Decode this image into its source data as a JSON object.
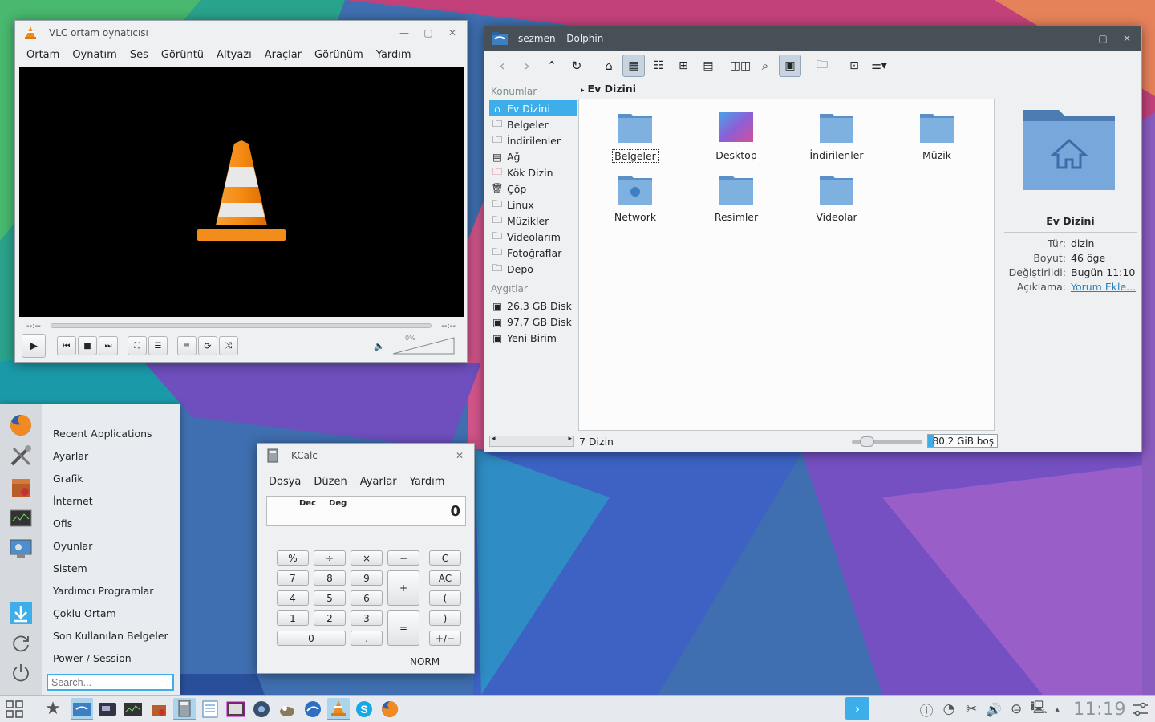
{
  "vlc": {
    "title": "VLC ortam oynatıcısı",
    "menu": [
      "Ortam",
      "Oynatım",
      "Ses",
      "Görüntü",
      "Altyazı",
      "Araçlar",
      "Görünüm",
      "Yardım"
    ],
    "elapsed": "--:--",
    "remaining": "--:--",
    "volume": "0%"
  },
  "dolphin": {
    "title": "sezmen – Dolphin",
    "places_header": "Konumlar",
    "places": [
      "Ev Dizini",
      "Belgeler",
      "İndirilenler",
      "Ağ",
      "Kök Dizin",
      "Çöp",
      "Linux",
      "Müzikler",
      "Videolarım",
      "Fotoğraflar",
      "Depo"
    ],
    "devices_header": "Aygıtlar",
    "devices": [
      "26,3 GB Disk",
      "97,7 GB Disk",
      "Yeni Birim"
    ],
    "breadcrumb": "Ev Dizini",
    "files": [
      "Belgeler",
      "Desktop",
      "İndirilenler",
      "Müzik",
      "Network",
      "Resimler",
      "Videolar"
    ],
    "info": {
      "name": "Ev Dizini",
      "type_label": "Tür:",
      "type_value": "dizin",
      "size_label": "Boyut:",
      "size_value": "46 öge",
      "modified_label": "Değiştirildi:",
      "modified_value": "Bugün 11:10",
      "comment_label": "Açıklama:",
      "comment_value": "Yorum Ekle..."
    },
    "status": "7 Dizin",
    "free_space": "80,2 GiB boş",
    "free_fraction": 0.08
  },
  "kcalc": {
    "title": "KCalc",
    "menu": [
      "Dosya",
      "Düzen",
      "Ayarlar",
      "Yardım"
    ],
    "flag_base": "Dec",
    "flag_angle": "Deg",
    "display": "0",
    "keys": {
      "percent": "%",
      "divide": "÷",
      "multiply": "×",
      "minus": "−",
      "clear": "C",
      "k7": "7",
      "k8": "8",
      "k9": "9",
      "plus": "+",
      "allclear": "AC",
      "k4": "4",
      "k5": "5",
      "k6": "6",
      "lparen": "(",
      "k1": "1",
      "k2": "2",
      "k3": "3",
      "equals": "=",
      "rparen": ")",
      "k0": "0",
      "dot": ".",
      "sign": "+/−"
    },
    "mode": "NORM"
  },
  "startmenu": {
    "categories": [
      "Recent Applications",
      "Ayarlar",
      "Grafik",
      "İnternet",
      "Ofis",
      "Oyunlar",
      "Sistem",
      "Yardımcı Programlar",
      "Çoklu Ortam",
      "Son Kullanılan Belgeler",
      "Power / Session"
    ],
    "search_placeholder": "Search..."
  },
  "panel": {
    "clock": "11:19"
  },
  "colors": {
    "accent": "#3daee9",
    "folder": "#6a9fd4",
    "dark_titlebar": "#475057"
  }
}
